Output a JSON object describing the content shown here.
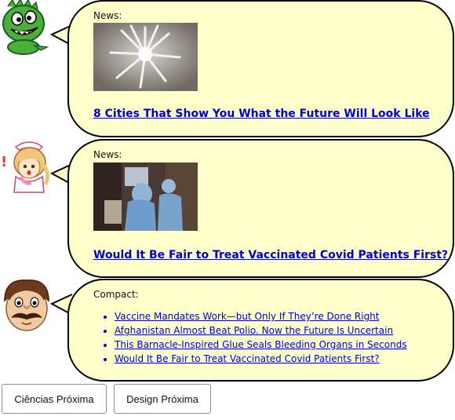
{
  "feed": {
    "item1": {
      "label": "News:",
      "headline": "8 Cities That Show You What the Future Will Look Like"
    },
    "item2": {
      "label": "News:",
      "headline": "Would It Be Fair to Treat Vaccinated Covid Patients First?"
    },
    "item3": {
      "label": "Compact:",
      "links": [
        "Vaccine Mandates Work—but Only If They’re Done Right",
        "Afghanistan Almost Beat Polio. Now the Future Is Uncertain",
        "This Barnacle-Inspired Glue Seals Bleeding Organs in Seconds",
        "Would It Be Fair to Treat Vaccinated Covid Patients First?"
      ]
    }
  },
  "nav": {
    "prev_label": "Ciências Próxima",
    "next_label": "Design Próxima"
  },
  "colors": {
    "bubble_fill": "#ffffcc",
    "link": "#0000cc",
    "dino": "#4caf3a",
    "nurse_hair": "#f2c57c"
  },
  "icons": {
    "avatar1": "green-dinosaur-icon",
    "avatar2": "nurse-icon",
    "avatar3": "mustache-man-icon"
  }
}
